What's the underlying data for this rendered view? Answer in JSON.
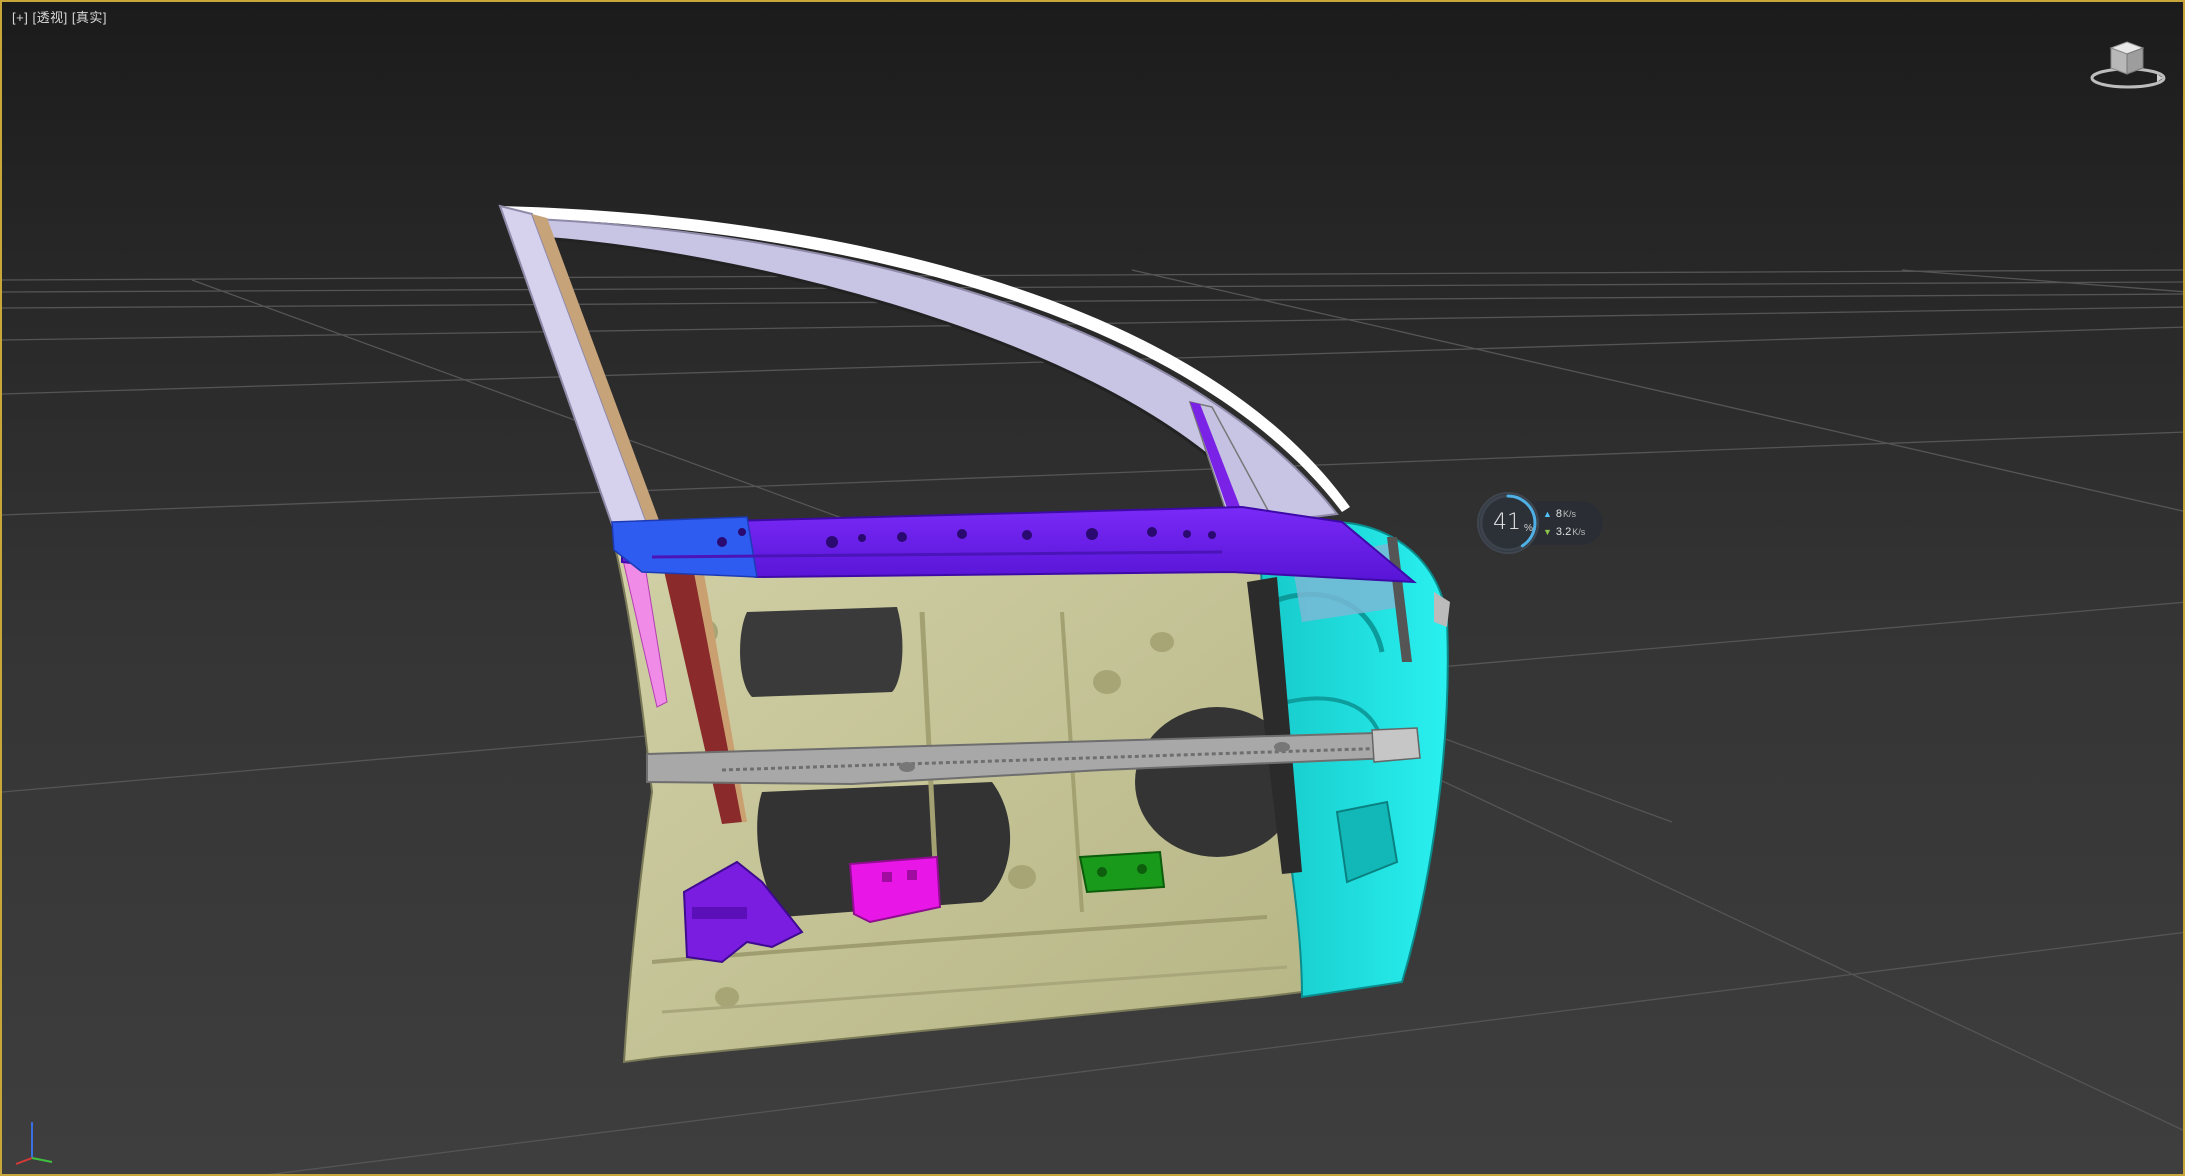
{
  "viewport": {
    "label_parts": [
      "[+]",
      "[透视]",
      "[真实]"
    ]
  },
  "network_monitor": {
    "percent": "41",
    "percent_unit": "%",
    "upload_value": "8",
    "upload_unit": "K/s",
    "download_value": "3.2",
    "download_unit": "K/s"
  },
  "icons": {
    "viewcube": "viewcube-icon",
    "axis": "axis-tripod-icon",
    "upload": "arrow-up-icon",
    "download": "arrow-down-icon"
  },
  "colors": {
    "viewport_border": "#c8a63a",
    "inner_panel": "#c9c79a",
    "impact_beam": "#a6a6a6",
    "belt_rail": "#6a1cf0",
    "hinge_reinforcement": "#19dcdc",
    "window_frame": "#d6d2ee",
    "magenta_bracket": "#e817e8",
    "green_bracket": "#1a9a1a"
  }
}
